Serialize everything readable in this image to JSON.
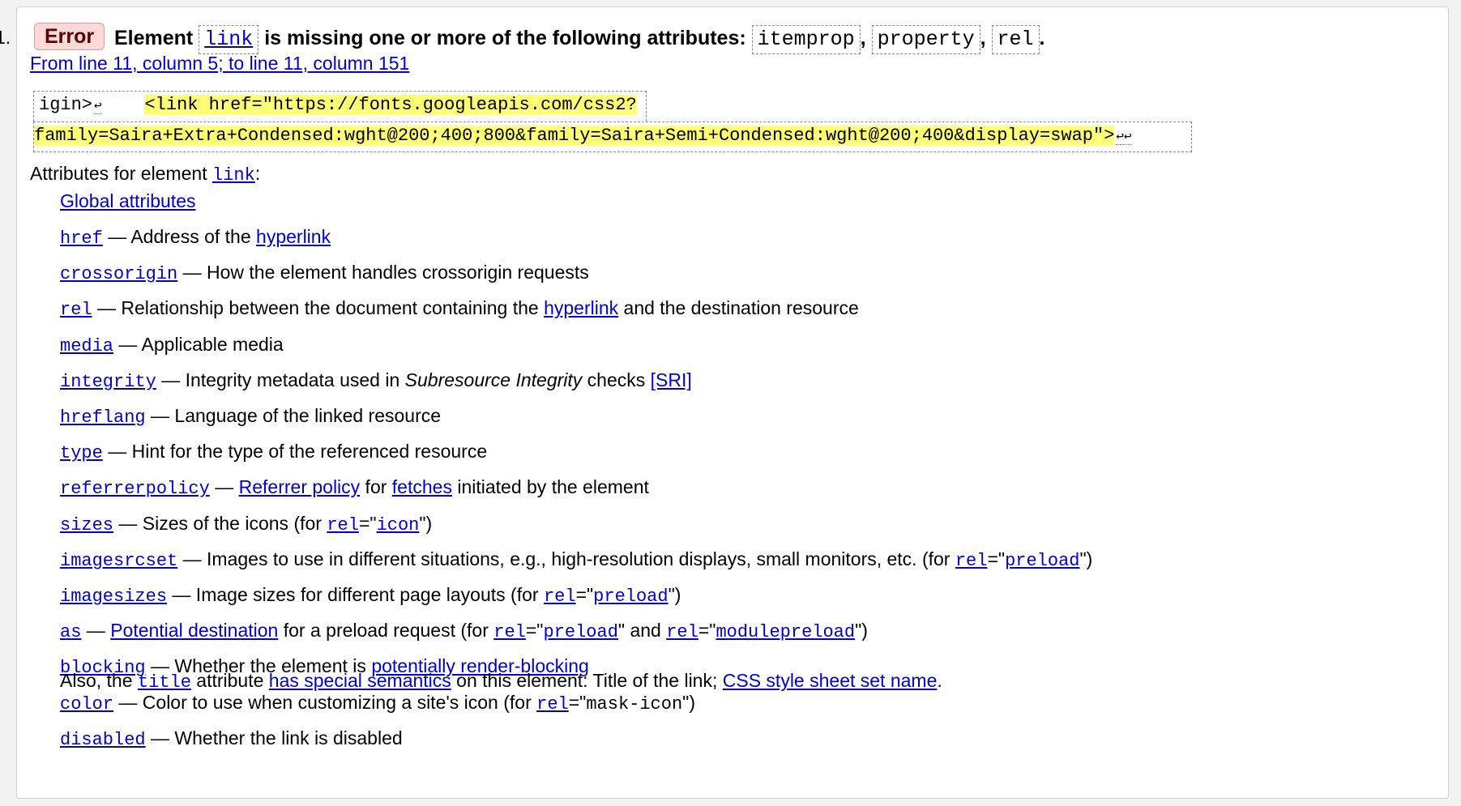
{
  "list_number": "1.",
  "message": {
    "badge": "Error",
    "text_element": "Element",
    "element_name": "link",
    "text_missing": "is missing one or more of the following attributes:",
    "attributes": [
      "itemprop",
      "property",
      "rel"
    ],
    "sep1": ",",
    "sep2": ",",
    "end": "."
  },
  "location": "From line 11, column 5; to line 11, column 151",
  "extract": {
    "line1_prefix": "igin>",
    "line1_ret": "↩",
    "line1_highlight": "<link href=\"https://fonts.googleapis.com/css2?",
    "line2_highlight": "family=Saira+Extra+Condensed:wght@200;400;800&family=Saira+Semi+Condensed:wght@200;400&display=swap\">",
    "line2_ret": "↩↩"
  },
  "attrs_intro": {
    "prefix": "Attributes for element",
    "element": "link",
    "suffix": ":"
  },
  "global_attributes": "Global attributes",
  "attrs": [
    {
      "name": "href",
      "parts": [
        {
          "t": " — Address of the "
        },
        {
          "l": "hyperlink"
        }
      ]
    },
    {
      "name": "crossorigin",
      "parts": [
        {
          "t": " — How the element handles crossorigin requests"
        }
      ]
    },
    {
      "name": "rel",
      "parts": [
        {
          "t": " — Relationship between the document containing the "
        },
        {
          "l": "hyperlink"
        },
        {
          "t": " and the destination resource"
        }
      ]
    },
    {
      "name": "media",
      "parts": [
        {
          "t": " — Applicable media"
        }
      ]
    },
    {
      "name": "integrity",
      "parts": [
        {
          "t": " — Integrity metadata used in "
        },
        {
          "i": "Subresource Integrity"
        },
        {
          "t": " checks "
        },
        {
          "l": "[SRI]"
        }
      ]
    },
    {
      "name": "hreflang",
      "parts": [
        {
          "t": " — Language of the linked resource"
        }
      ]
    },
    {
      "name": "type",
      "parts": [
        {
          "t": " — Hint for the type of the referenced resource"
        }
      ]
    },
    {
      "name": "referrerpolicy",
      "parts": [
        {
          "t": " — "
        },
        {
          "l": "Referrer policy"
        },
        {
          "t": " for "
        },
        {
          "l": "fetches"
        },
        {
          "t": " initiated by the element"
        }
      ]
    },
    {
      "name": "sizes",
      "parts": [
        {
          "t": " — Sizes of the icons (for "
        },
        {
          "c": "rel"
        },
        {
          "t": "=\""
        },
        {
          "c": "icon"
        },
        {
          "t": "\")"
        }
      ]
    },
    {
      "name": "imagesrcset",
      "parts": [
        {
          "t": " — Images to use in different situations, e.g., high-resolution displays, small monitors, etc. (for "
        },
        {
          "c": "rel"
        },
        {
          "t": "=\""
        },
        {
          "c": "preload"
        },
        {
          "t": "\")"
        }
      ]
    },
    {
      "name": "imagesizes",
      "parts": [
        {
          "t": " — Image sizes for different page layouts (for "
        },
        {
          "c": "rel"
        },
        {
          "t": "=\""
        },
        {
          "c": "preload"
        },
        {
          "t": "\")"
        }
      ]
    },
    {
      "name": "as",
      "parts": [
        {
          "t": " — "
        },
        {
          "l": "Potential destination"
        },
        {
          "t": " for a preload request (for "
        },
        {
          "c": "rel"
        },
        {
          "t": "=\""
        },
        {
          "c": "preload"
        },
        {
          "t": "\" and "
        },
        {
          "c": "rel"
        },
        {
          "t": "=\""
        },
        {
          "c": "modulepreload"
        },
        {
          "t": "\")"
        }
      ]
    },
    {
      "name": "blocking",
      "parts": [
        {
          "t": " — Whether the element is "
        },
        {
          "l": "potentially render-blocking"
        }
      ]
    },
    {
      "name": "color",
      "parts": [
        {
          "t": " — Color to use when customizing a site's icon (for "
        },
        {
          "c": "rel"
        },
        {
          "t": "=\""
        },
        {
          "m": "mask-icon"
        },
        {
          "t": "\")"
        }
      ]
    },
    {
      "name": "disabled",
      "parts": [
        {
          "t": " — Whether the link is disabled"
        }
      ]
    }
  ],
  "also": {
    "prefix": "Also, the ",
    "attr": "title",
    "mid": " attribute ",
    "link1": "has special semantics",
    "text": " on this element: Title of the link; ",
    "link2": "CSS style sheet set name",
    "end": "."
  }
}
